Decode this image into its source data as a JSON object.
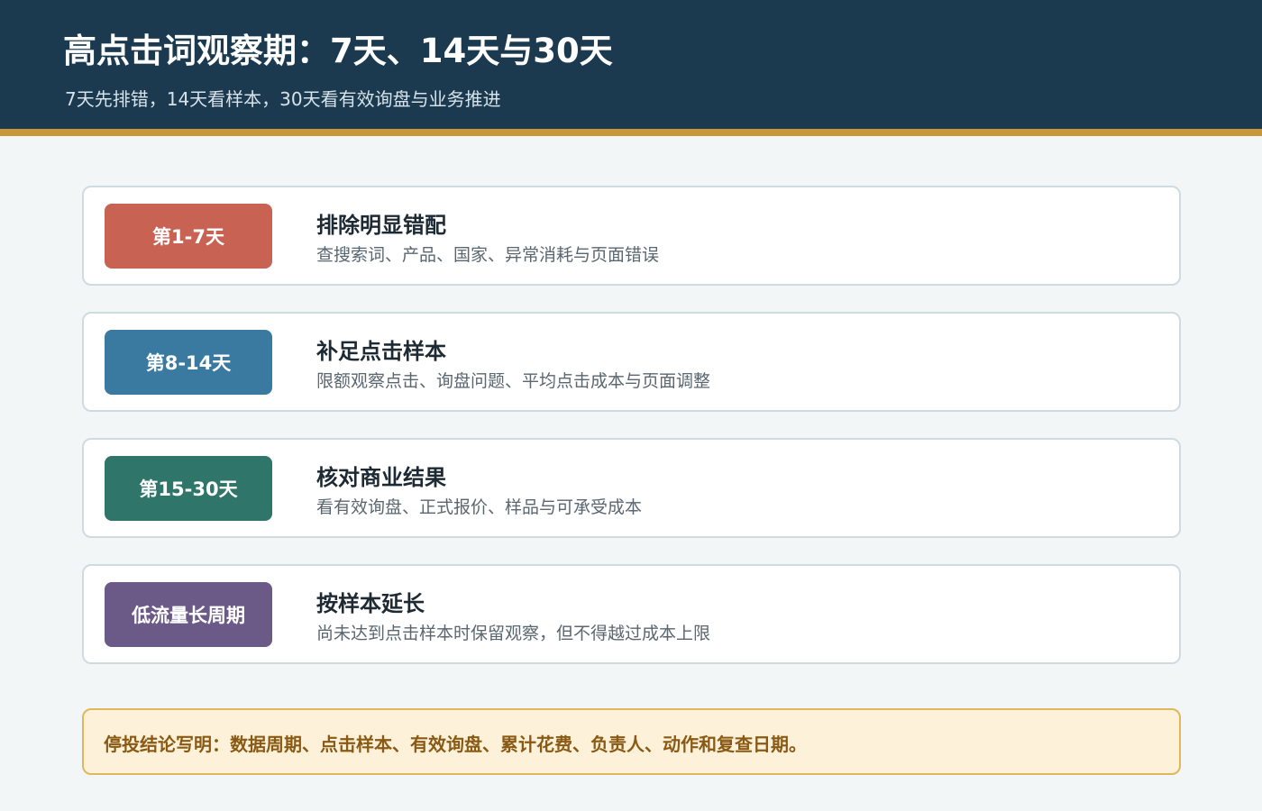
{
  "header": {
    "title": "高点击词观察期：7天、14天与30天",
    "subtitle": "7天先排错，14天看样本，30天看有效询盘与业务推进"
  },
  "stages": [
    {
      "badge": "第1-7天",
      "badge_color": "#c86253",
      "title": "排除明显错配",
      "description": "查搜索词、产品、国家、异常消耗与页面错误"
    },
    {
      "badge": "第8-14天",
      "badge_color": "#3a7aa0",
      "title": "补足点击样本",
      "description": "限额观察点击、询盘问题、平均点击成本与页面调整"
    },
    {
      "badge": "第15-30天",
      "badge_color": "#2f7569",
      "title": "核对商业结果",
      "description": "看有效询盘、正式报价、样品与可承受成本"
    },
    {
      "badge": "低流量长周期",
      "badge_color": "#6b5a87",
      "title": "按样本延长",
      "description": "尚未达到点击样本时保留观察，但不得越过成本上限"
    }
  ],
  "note": {
    "text": "停投结论写明：数据周期、点击样本、有效询盘、累计花费、负责人、动作和复查日期。"
  },
  "colors": {
    "header_bg": "#1b3a4f",
    "header_rule": "#c9973a",
    "note_bg": "#fdf2d9",
    "note_border": "#e0b75d"
  }
}
